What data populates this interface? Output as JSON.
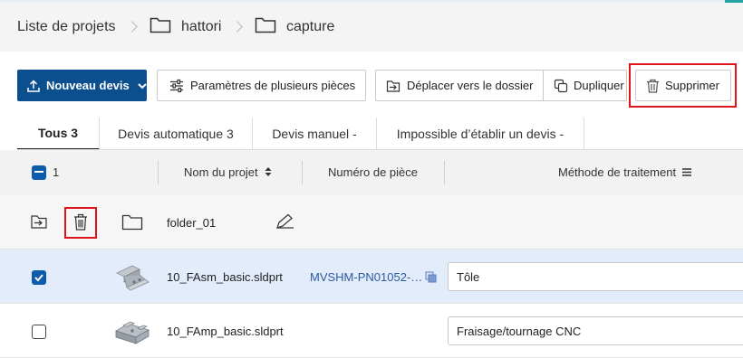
{
  "breadcrumb": {
    "root": "Liste de projets",
    "items": [
      "hattori",
      "capture"
    ]
  },
  "toolbar": {
    "new_quote_label": "Nouveau devis",
    "multi_params_label": "Paramètres de plusieurs pièces",
    "move_label": "Déplacer vers le dossier",
    "duplicate_label": "Dupliquer",
    "delete_label": "Supprimer"
  },
  "tabs": [
    {
      "label": "Tous 3",
      "active": true
    },
    {
      "label": "Devis automatique 3",
      "active": false
    },
    {
      "label": "Devis manuel -",
      "active": false
    },
    {
      "label": "Impossible d’établir un devis -",
      "active": false
    }
  ],
  "table": {
    "selected_count": "1",
    "columns": [
      "Nom du projet",
      "Numéro de pièce",
      "Méthode de traitement"
    ],
    "folder_row": {
      "name": "folder_01"
    },
    "rows": [
      {
        "name": "10_FAsm_basic.sldprt",
        "part_number": "MVSHM-PN01052-…",
        "method": "Tôle",
        "checked": true
      },
      {
        "name": "10_FAmp_basic.sldprt",
        "part_number": "",
        "method": "Fraisage/tournage CNC",
        "checked": false
      }
    ]
  },
  "colors": {
    "primary": "#0b4f8f",
    "highlight": "#e0151b",
    "link": "#2c5aa0",
    "selected_row": "#e2ecfb"
  }
}
